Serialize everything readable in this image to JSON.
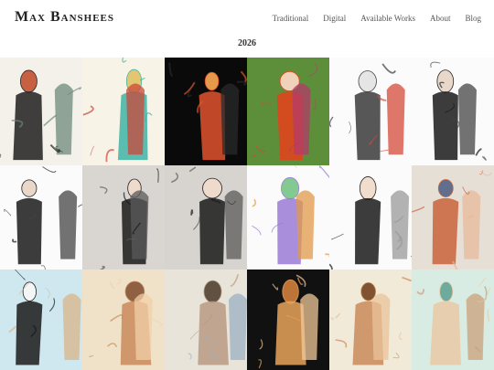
{
  "site": {
    "title": "Max Banshees"
  },
  "nav": {
    "items": [
      {
        "label": "Traditional"
      },
      {
        "label": "Digital"
      },
      {
        "label": "Available Works"
      },
      {
        "label": "About"
      },
      {
        "label": "Blog"
      }
    ]
  },
  "gallery": {
    "year": "2026",
    "artworks": [
      {
        "bg": "#f4f1ea",
        "accent": "#1e1e1e",
        "accent2": "#c55a3a",
        "accent3": "#6e8a7a"
      },
      {
        "bg": "#f7f3e6",
        "accent": "#3fb3a4",
        "accent2": "#e2c46a",
        "accent3": "#c9473a"
      },
      {
        "bg": "#0a0a0a",
        "accent": "#e0542e",
        "accent2": "#f2a24d",
        "accent3": "#2a2a2a"
      },
      {
        "bg": "#5d8f3a",
        "accent": "#e8411c",
        "accent2": "#f7d6c0",
        "accent3": "#b43a6a"
      },
      {
        "bg": "#fbfbfb",
        "accent": "#3a3a3a",
        "accent2": "#e4e4e4",
        "accent3": "#d44a3a"
      },
      {
        "bg": "#fbfbfb",
        "accent": "#1a1a1a",
        "accent2": "#e9d7c7",
        "accent3": "#444444"
      },
      {
        "bg": "#fbfbfb",
        "accent": "#1a1a1a",
        "accent2": "#e9d7c7",
        "accent3": "#444444"
      },
      {
        "bg": "#d9d6d2",
        "accent": "#1a1a1a",
        "accent2": "#f1dccb",
        "accent3": "#5a5a5a"
      },
      {
        "bg": "#d7d4cf",
        "accent": "#1a1a1a",
        "accent2": "#f1dccb",
        "accent3": "#5a5a5a"
      },
      {
        "bg": "#fbfbfb",
        "accent": "#9a7ad6",
        "accent2": "#7cc88a",
        "accent3": "#e29a4a"
      },
      {
        "bg": "#fbfbfb",
        "accent": "#1a1a1a",
        "accent2": "#f1dccb",
        "accent3": "#9a9a9a"
      },
      {
        "bg": "#e6dfd6",
        "accent": "#c9633a",
        "accent2": "#5a6a8a",
        "accent3": "#e7b99a"
      },
      {
        "bg": "#cfe8ef",
        "accent": "#1a1a1a",
        "accent2": "#f7f7f7",
        "accent3": "#d9b48a"
      },
      {
        "bg": "#efe2c8",
        "accent": "#c98a5a",
        "accent2": "#8a5a3a",
        "accent3": "#f2cfa8"
      },
      {
        "bg": "#e9e4d9",
        "accent": "#b99a82",
        "accent2": "#5a4a3a",
        "accent3": "#9ab0c2"
      },
      {
        "bg": "#111111",
        "accent": "#e8a45a",
        "accent2": "#c97a3a",
        "accent3": "#f2c89a"
      },
      {
        "bg": "#f1ead8",
        "accent": "#c98a5a",
        "accent2": "#7a4a2a",
        "accent3": "#e9c39a"
      },
      {
        "bg": "#d9ece4",
        "accent": "#e9c9a4",
        "accent2": "#6aa89a",
        "accent3": "#c9a07a"
      }
    ]
  }
}
